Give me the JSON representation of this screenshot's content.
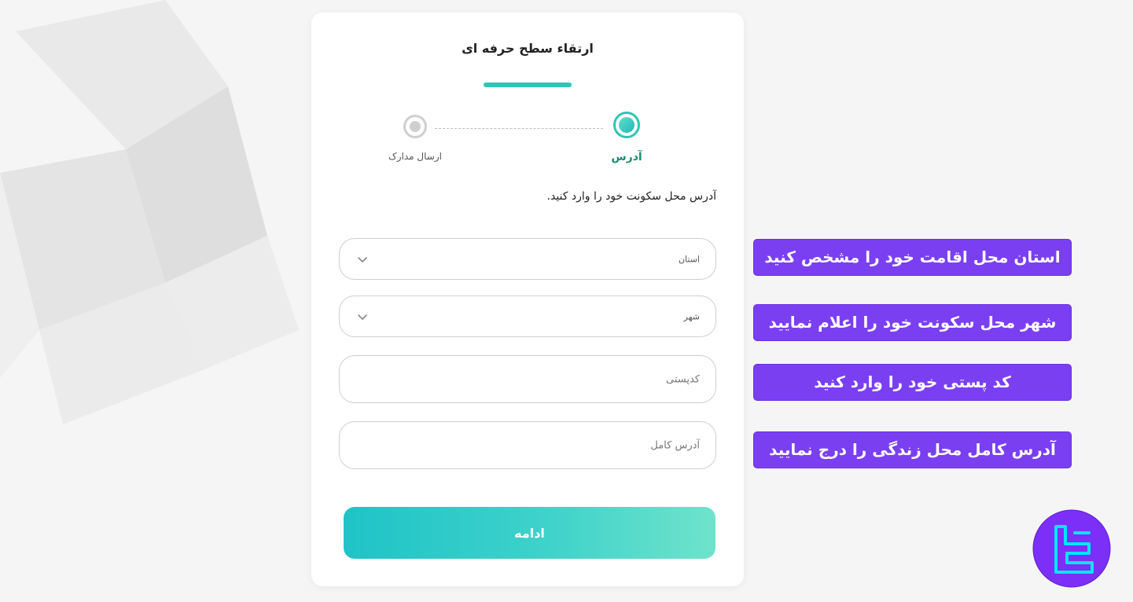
{
  "card": {
    "title": "ارتقاء سطح حرفه ای"
  },
  "stepper": {
    "steps": [
      {
        "label": "آدرس",
        "state": "active"
      },
      {
        "label": "ارسال مدارک",
        "state": "inactive"
      }
    ]
  },
  "form": {
    "instruction": "آدرس محل سکونت خود را وارد کنید.",
    "province_placeholder": "استان",
    "city_placeholder": "شهر",
    "postal_code_placeholder": "کدپستی",
    "full_address_placeholder": "آدرس کامل",
    "submit_label": "ادامه"
  },
  "tips": [
    "استان محل اقامت خود را مشخص کنید",
    "شهر محل سکونت خود را اعلام نمایید",
    "کد پستی خود را وارد کنید",
    "آدرس کامل محل زندگی را درج نمایید"
  ],
  "colors": {
    "accent": "#2ec4b6",
    "active_step_label": "#1c8b74",
    "tip_background": "#7b3ff2",
    "logo_circle": "#7b2ff7",
    "logo_mark": "#00e5ff"
  },
  "icons": {
    "dropdown": "chevron-down-icon",
    "logo": "brand-logo-icon"
  }
}
